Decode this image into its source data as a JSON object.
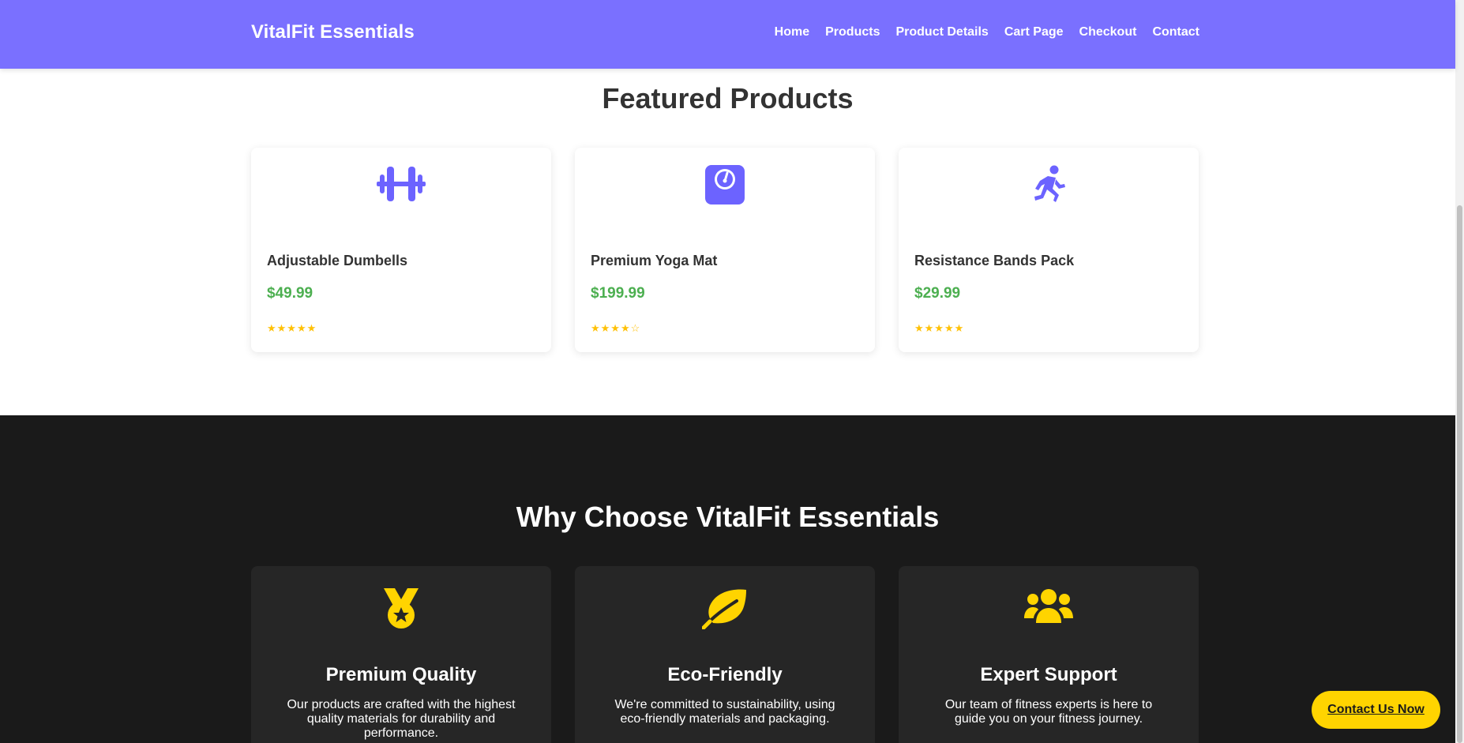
{
  "header": {
    "brand": "VitalFit Essentials",
    "nav": [
      "Home",
      "Products",
      "Product Details",
      "Cart Page",
      "Checkout",
      "Contact"
    ]
  },
  "featured": {
    "title": "Featured Products",
    "products": [
      {
        "icon": "dumbbell-icon",
        "name": "Adjustable Dumbells",
        "price": "$49.99",
        "rating": "★★★★★"
      },
      {
        "icon": "weight-scale-icon",
        "name": "Premium Yoga Mat",
        "price": "$199.99",
        "rating": "★★★★☆"
      },
      {
        "icon": "running-person-icon",
        "name": "Resistance Bands Pack",
        "price": "$29.99",
        "rating": "★★★★★"
      }
    ]
  },
  "why": {
    "title": "Why Choose VitalFit Essentials",
    "features": [
      {
        "icon": "medal-icon",
        "title": "Premium Quality",
        "desc": "Our products are crafted with the highest quality materials for durability and performance."
      },
      {
        "icon": "leaf-icon",
        "title": "Eco-Friendly",
        "desc": "We're committed to sustainability, using eco-friendly materials and packaging."
      },
      {
        "icon": "users-icon",
        "title": "Expert Support",
        "desc": "Our team of fitness experts is here to guide you on your fitness journey."
      }
    ]
  },
  "cta": {
    "label": "Contact Us Now"
  },
  "colors": {
    "nav_bg": "#7a70ff",
    "accent_purple": "#6c63ff",
    "price_green": "#4caf50",
    "star_yellow": "#ffc107",
    "dark_bg": "#1a1a1a",
    "card_dark": "#262626",
    "cta_yellow": "#ffd400"
  }
}
